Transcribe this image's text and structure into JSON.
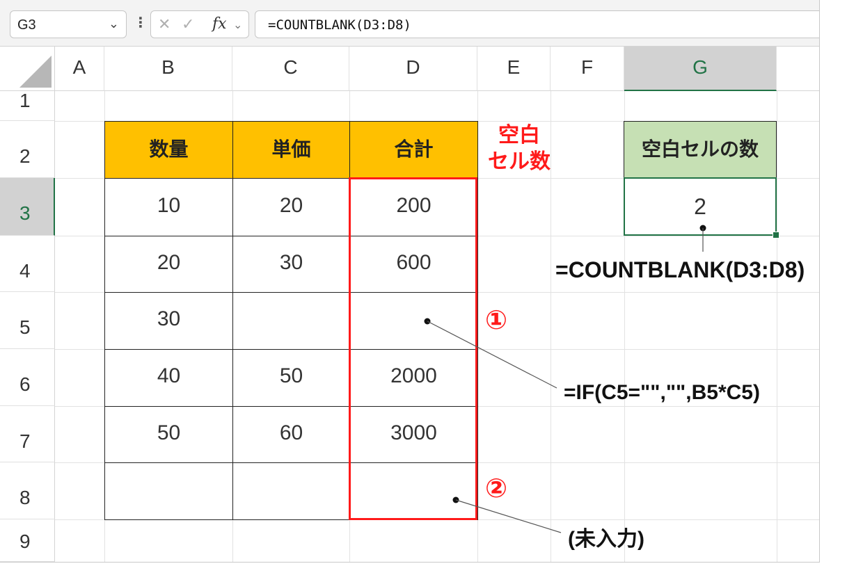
{
  "formula_bar": {
    "name_box": "G3",
    "cancel_icon": "✕",
    "enter_icon": "✓",
    "fx_label": "fx",
    "formula": "=COUNTBLANK(D3:D8)"
  },
  "columns": [
    "A",
    "B",
    "C",
    "D",
    "E",
    "F",
    "G"
  ],
  "rows": [
    "1",
    "2",
    "3",
    "4",
    "5",
    "6",
    "7",
    "8",
    "9"
  ],
  "selected_cell": {
    "column": "G",
    "row": "3"
  },
  "table": {
    "headers": [
      "数量",
      "単価",
      "合計"
    ],
    "rows": [
      [
        "10",
        "20",
        "200"
      ],
      [
        "20",
        "30",
        "600"
      ],
      [
        "30",
        "",
        ""
      ],
      [
        "40",
        "50",
        "2000"
      ],
      [
        "50",
        "60",
        "3000"
      ],
      [
        "",
        "",
        ""
      ]
    ]
  },
  "side_label": {
    "line1": "空白",
    "line2": "セル数"
  },
  "result": {
    "header": "空白セルの数",
    "value": "2"
  },
  "annotations": {
    "countblank_formula": "=COUNTBLANK(D3:D8)",
    "marker1": "①",
    "if_formula": "=IF(C5=\"\",\"\",B5*C5)",
    "marker2": "②",
    "unentered": "(未入力)"
  },
  "colors": {
    "table_header": "#ffc000",
    "result_header": "#c6e0b4",
    "highlight_red": "#ff1a1a",
    "excel_green": "#217346"
  }
}
